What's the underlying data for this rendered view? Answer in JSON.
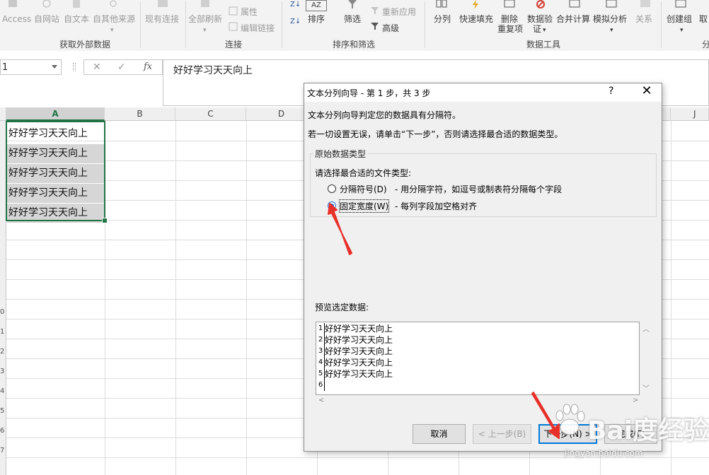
{
  "ribbon": {
    "buttons": {
      "access": "Access",
      "web": "自网站",
      "text": "自文本",
      "other": "自其他来源",
      "existing": "现有连接",
      "refresh": "全部刷新",
      "properties": "属性",
      "edit_links": "编辑链接",
      "sort": "排序",
      "filter": "筛选",
      "reapply": "重新应用",
      "advanced": "高级",
      "split": "分列",
      "flash_fill": "快速填充",
      "remove_dup_1": "删除",
      "remove_dup_2": "重复项",
      "validate_1": "数据验",
      "validate_2": "证",
      "consolidate": "合并计算",
      "whatif": "模拟分析",
      "relations": "关系",
      "group": "创建组",
      "cut_off": "取"
    },
    "groups": {
      "get_external": "获取外部数据",
      "connections": "连接",
      "sort_filter": "排序和筛选",
      "data_tools": "数据工具",
      "cut_off": "分"
    }
  },
  "formula_bar": {
    "name_box": "1",
    "cancel_glyph": "✕",
    "enter_glyph": "✓",
    "fx": "fx",
    "value": "好好学习天天向上"
  },
  "sheet": {
    "columns": [
      "A",
      "B",
      "C",
      "D",
      "J"
    ],
    "row_numbers": [
      "0",
      "1",
      "2",
      "3",
      "4",
      "5",
      "6",
      "7"
    ],
    "cells": [
      "好好学习天天向上",
      "好好学习天天向上",
      "好好学习天天向上",
      "好好学习天天向上",
      "好好学习天天向上"
    ]
  },
  "dialog": {
    "title": "文本分列向导 - 第 1 步，共 3 步",
    "help": "?",
    "close": "✕",
    "intro": "文本分列向导判定您的数据具有分隔符。",
    "instruction": "若一切设置无误，请单击“下一步”，否则请选择最合适的数据类型。",
    "group_label": "原始数据类型",
    "choose_label": "请选择最合适的文件类型:",
    "options": [
      {
        "label": "分隔符号(D)",
        "desc": "- 用分隔字符，如逗号或制表符分隔每个字段",
        "selected": false
      },
      {
        "label": "固定宽度(W)",
        "desc": "- 每列字段加空格对齐",
        "selected": true
      }
    ],
    "preview_label": "预览选定数据:",
    "preview_rows": [
      {
        "n": "1",
        "text": "好好学习天天向上"
      },
      {
        "n": "2",
        "text": "好好学习天天向上"
      },
      {
        "n": "3",
        "text": "好好学习天天向上"
      },
      {
        "n": "4",
        "text": "好好学习天天向上"
      },
      {
        "n": "5",
        "text": "好好学习天天向上"
      },
      {
        "n": "6",
        "text": ""
      }
    ],
    "buttons": {
      "cancel": "取消",
      "back": "< 上一步(B)",
      "next": "下一步(N) >",
      "finish": "完成(F)"
    }
  },
  "watermark": {
    "text": "Bai度经验",
    "url": "jingyan.baidu.com"
  },
  "colors": {
    "excel_green": "#217346",
    "annotation_red": "#e8302a",
    "radio_blue": "#1f6fd0"
  }
}
